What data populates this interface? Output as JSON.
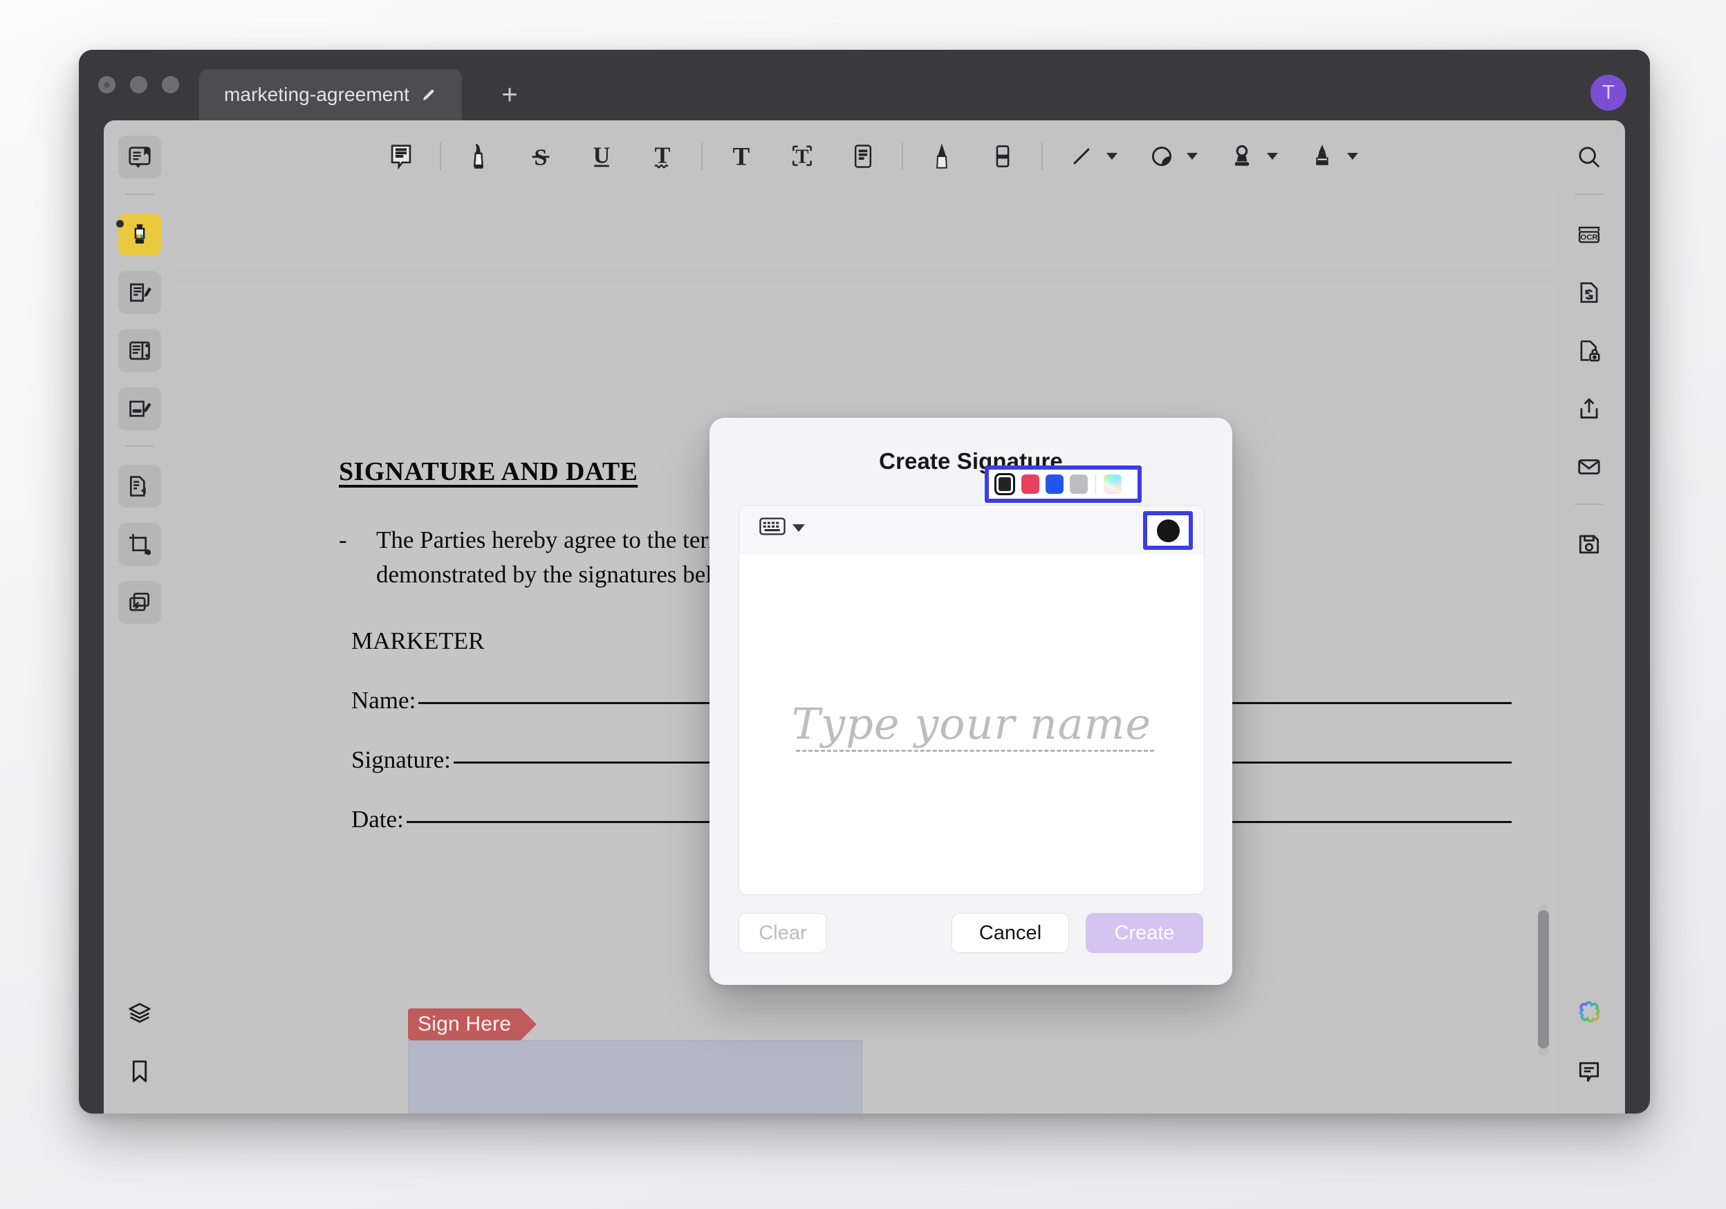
{
  "window": {
    "tab_title": "marketing-agreement",
    "new_tab_label": "+",
    "avatar_initial": "T",
    "edit_icon": "pencil-icon"
  },
  "toolbar": {
    "items": [
      {
        "name": "note-tool",
        "icon": "sticky-note-icon",
        "has_dropdown": false
      },
      {
        "name": "highlight-tool",
        "icon": "highlighter-icon",
        "has_dropdown": false
      },
      {
        "name": "strikethrough-tool",
        "icon": "strikethrough-icon",
        "has_dropdown": false
      },
      {
        "name": "underline-tool",
        "icon": "underline-icon",
        "has_dropdown": false
      },
      {
        "name": "squiggly-underline-tool",
        "icon": "squiggly-underline-icon",
        "has_dropdown": false
      },
      {
        "name": "text-tool",
        "icon": "text-icon",
        "has_dropdown": false
      },
      {
        "name": "text-box-tool",
        "icon": "text-box-icon",
        "has_dropdown": false
      },
      {
        "name": "note-box-tool",
        "icon": "note-box-icon",
        "has_dropdown": false
      },
      {
        "name": "pen-tool",
        "icon": "pen-icon",
        "has_dropdown": false
      },
      {
        "name": "eraser-tool",
        "icon": "eraser-icon",
        "has_dropdown": false
      },
      {
        "name": "line-tool",
        "icon": "line-icon",
        "has_dropdown": true
      },
      {
        "name": "shape-tool",
        "icon": "shape-icon",
        "has_dropdown": true
      },
      {
        "name": "stamp-tool",
        "icon": "stamp-icon",
        "has_dropdown": true
      },
      {
        "name": "signature-tool",
        "icon": "fountain-pen-icon",
        "has_dropdown": true
      }
    ]
  },
  "left_rail": {
    "items": [
      {
        "name": "reader-view",
        "icon": "book-bookmark-icon"
      },
      {
        "name": "highlight-panel",
        "icon": "highlighter-icon",
        "active": true
      },
      {
        "name": "annotate-panel",
        "icon": "edit-document-icon"
      },
      {
        "name": "page-layout-panel",
        "icon": "page-layout-icon"
      },
      {
        "name": "fill-and-sign-panel",
        "icon": "sign-document-icon"
      },
      {
        "name": "copy-pages",
        "icon": "copy-pages-icon"
      },
      {
        "name": "crop-page",
        "icon": "crop-icon"
      },
      {
        "name": "organize-pages",
        "icon": "stack-pages-icon"
      },
      {
        "name": "layers-panel",
        "icon": "layers-icon"
      },
      {
        "name": "bookmarks-panel",
        "icon": "bookmark-icon"
      }
    ]
  },
  "right_rail": {
    "items": [
      {
        "name": "search",
        "icon": "search-icon"
      },
      {
        "name": "ocr",
        "icon": "ocr-icon",
        "label": "OCR"
      },
      {
        "name": "convert",
        "icon": "convert-document-icon"
      },
      {
        "name": "protect",
        "icon": "lock-document-icon"
      },
      {
        "name": "share",
        "icon": "share-icon"
      },
      {
        "name": "email",
        "icon": "mail-icon"
      },
      {
        "name": "save",
        "icon": "save-icon"
      },
      {
        "name": "ai-assistant",
        "icon": "ai-flower-icon"
      },
      {
        "name": "comments",
        "icon": "comment-icon"
      }
    ]
  },
  "document": {
    "heading": "SIGNATURE AND DATE",
    "bullet_dash": "-",
    "bullet_text": "The Parties hereby agree to the terms set forth in this Agreement. This agreement is demonstrated by the signatures below.",
    "party_label": "MARKETER",
    "fields": [
      {
        "label": "Name:"
      },
      {
        "label": "Signature:"
      },
      {
        "label": "Date:"
      }
    ],
    "sign_tag": "Sign Here"
  },
  "dialog": {
    "title": "Create Signature",
    "input_mode_icon": "keyboard-icon",
    "color_button_icon": "color-circle-icon",
    "selected_color": "#161618",
    "palette": {
      "colors": [
        {
          "name": "black",
          "hex": "#242426",
          "selected": true
        },
        {
          "name": "red",
          "hex": "#e8415f",
          "selected": false
        },
        {
          "name": "blue",
          "hex": "#2455ec",
          "selected": false
        },
        {
          "name": "gray",
          "hex": "#bdbdbf",
          "selected": false
        },
        {
          "name": "custom-color-picker",
          "hex": "rainbow",
          "selected": false
        }
      ]
    },
    "canvas_placeholder": "Type your name",
    "buttons": {
      "clear": "Clear",
      "cancel": "Cancel",
      "create": "Create"
    },
    "highlight_color": "#3d3de0"
  }
}
